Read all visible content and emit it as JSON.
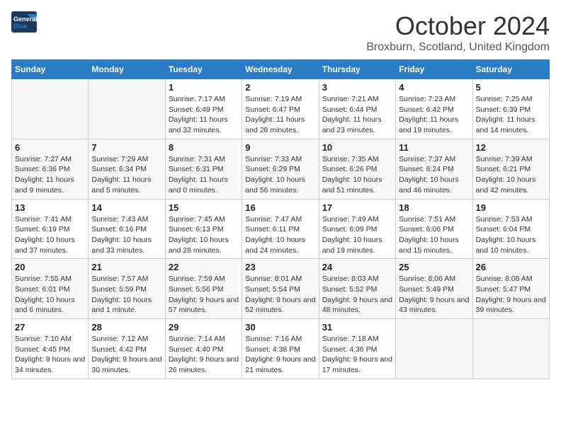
{
  "header": {
    "logo_line1": "General",
    "logo_line2": "Blue",
    "month": "October 2024",
    "location": "Broxburn, Scotland, United Kingdom"
  },
  "days_of_week": [
    "Sunday",
    "Monday",
    "Tuesday",
    "Wednesday",
    "Thursday",
    "Friday",
    "Saturday"
  ],
  "weeks": [
    [
      {
        "day": "",
        "info": ""
      },
      {
        "day": "",
        "info": ""
      },
      {
        "day": "1",
        "sunrise": "7:17 AM",
        "sunset": "6:49 PM",
        "daylight": "11 hours and 32 minutes."
      },
      {
        "day": "2",
        "sunrise": "7:19 AM",
        "sunset": "6:47 PM",
        "daylight": "11 hours and 28 minutes."
      },
      {
        "day": "3",
        "sunrise": "7:21 AM",
        "sunset": "6:44 PM",
        "daylight": "11 hours and 23 minutes."
      },
      {
        "day": "4",
        "sunrise": "7:23 AM",
        "sunset": "6:42 PM",
        "daylight": "11 hours and 19 minutes."
      },
      {
        "day": "5",
        "sunrise": "7:25 AM",
        "sunset": "6:39 PM",
        "daylight": "11 hours and 14 minutes."
      }
    ],
    [
      {
        "day": "6",
        "sunrise": "7:27 AM",
        "sunset": "6:36 PM",
        "daylight": "11 hours and 9 minutes."
      },
      {
        "day": "7",
        "sunrise": "7:29 AM",
        "sunset": "6:34 PM",
        "daylight": "11 hours and 5 minutes."
      },
      {
        "day": "8",
        "sunrise": "7:31 AM",
        "sunset": "6:31 PM",
        "daylight": "11 hours and 0 minutes."
      },
      {
        "day": "9",
        "sunrise": "7:33 AM",
        "sunset": "6:29 PM",
        "daylight": "10 hours and 56 minutes."
      },
      {
        "day": "10",
        "sunrise": "7:35 AM",
        "sunset": "6:26 PM",
        "daylight": "10 hours and 51 minutes."
      },
      {
        "day": "11",
        "sunrise": "7:37 AM",
        "sunset": "6:24 PM",
        "daylight": "10 hours and 46 minutes."
      },
      {
        "day": "12",
        "sunrise": "7:39 AM",
        "sunset": "6:21 PM",
        "daylight": "10 hours and 42 minutes."
      }
    ],
    [
      {
        "day": "13",
        "sunrise": "7:41 AM",
        "sunset": "6:19 PM",
        "daylight": "10 hours and 37 minutes."
      },
      {
        "day": "14",
        "sunrise": "7:43 AM",
        "sunset": "6:16 PM",
        "daylight": "10 hours and 33 minutes."
      },
      {
        "day": "15",
        "sunrise": "7:45 AM",
        "sunset": "6:13 PM",
        "daylight": "10 hours and 28 minutes."
      },
      {
        "day": "16",
        "sunrise": "7:47 AM",
        "sunset": "6:11 PM",
        "daylight": "10 hours and 24 minutes."
      },
      {
        "day": "17",
        "sunrise": "7:49 AM",
        "sunset": "6:09 PM",
        "daylight": "10 hours and 19 minutes."
      },
      {
        "day": "18",
        "sunrise": "7:51 AM",
        "sunset": "6:06 PM",
        "daylight": "10 hours and 15 minutes."
      },
      {
        "day": "19",
        "sunrise": "7:53 AM",
        "sunset": "6:04 PM",
        "daylight": "10 hours and 10 minutes."
      }
    ],
    [
      {
        "day": "20",
        "sunrise": "7:55 AM",
        "sunset": "6:01 PM",
        "daylight": "10 hours and 6 minutes."
      },
      {
        "day": "21",
        "sunrise": "7:57 AM",
        "sunset": "5:59 PM",
        "daylight": "10 hours and 1 minute."
      },
      {
        "day": "22",
        "sunrise": "7:59 AM",
        "sunset": "5:56 PM",
        "daylight": "9 hours and 57 minutes."
      },
      {
        "day": "23",
        "sunrise": "8:01 AM",
        "sunset": "5:54 PM",
        "daylight": "9 hours and 52 minutes."
      },
      {
        "day": "24",
        "sunrise": "8:03 AM",
        "sunset": "5:52 PM",
        "daylight": "9 hours and 48 minutes."
      },
      {
        "day": "25",
        "sunrise": "8:06 AM",
        "sunset": "5:49 PM",
        "daylight": "9 hours and 43 minutes."
      },
      {
        "day": "26",
        "sunrise": "8:08 AM",
        "sunset": "5:47 PM",
        "daylight": "9 hours and 39 minutes."
      }
    ],
    [
      {
        "day": "27",
        "sunrise": "7:10 AM",
        "sunset": "4:45 PM",
        "daylight": "9 hours and 34 minutes."
      },
      {
        "day": "28",
        "sunrise": "7:12 AM",
        "sunset": "4:42 PM",
        "daylight": "9 hours and 30 minutes."
      },
      {
        "day": "29",
        "sunrise": "7:14 AM",
        "sunset": "4:40 PM",
        "daylight": "9 hours and 26 minutes."
      },
      {
        "day": "30",
        "sunrise": "7:16 AM",
        "sunset": "4:38 PM",
        "daylight": "9 hours and 21 minutes."
      },
      {
        "day": "31",
        "sunrise": "7:18 AM",
        "sunset": "4:36 PM",
        "daylight": "9 hours and 17 minutes."
      },
      {
        "day": "",
        "info": ""
      },
      {
        "day": "",
        "info": ""
      }
    ]
  ]
}
